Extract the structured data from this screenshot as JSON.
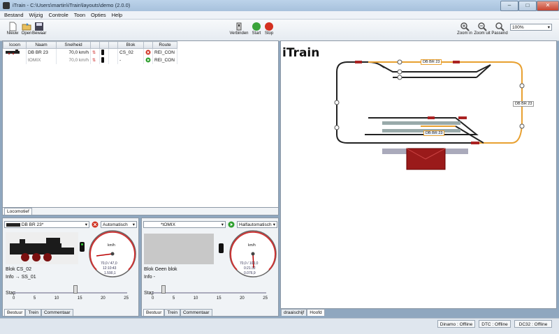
{
  "window": {
    "title": "iTrain - C:\\Users\\martin\\iTrain\\layouts\\demo (2.0.0)"
  },
  "menu": [
    "Bestand",
    "Wijzig",
    "Controle",
    "Toon",
    "Opties",
    "Help"
  ],
  "toolbar": {
    "new": "Nieuw",
    "open": "Open",
    "save": "Bewaar",
    "connect": "Verbinden",
    "start": "Start",
    "stop": "Stop",
    "zoom_in": "Zoom in",
    "zoom_out": "Zoom uit",
    "fit": "Passend",
    "zoom_value": "100%"
  },
  "loco_table": {
    "headers": [
      "Icoon",
      "Naam",
      "Snelheid",
      "Blok",
      "Route"
    ],
    "rows": [
      {
        "name": "DB BR 23",
        "speed": "70,0 km/h",
        "block": "CS_02",
        "route": "REI_CON"
      },
      {
        "name": "tOMIX",
        "speed": "70,0 km/h",
        "block": "-",
        "route": "REI_CON"
      }
    ]
  },
  "left_tabs": [
    "Locomotief"
  ],
  "control1": {
    "loco": "DB BR 23*",
    "mode": "Automatisch",
    "block_label": "Blok",
    "block_value": "CS_02",
    "info_label": "Info",
    "info_value": "→ SS_01",
    "step_label": "Stap",
    "gauge_unit": "km/h",
    "gauge_speed": "70,0 / 47,0",
    "gauge_time": "12:10:43",
    "gauge_dist": "1.590,1",
    "scale": [
      "0",
      "5",
      "10",
      "15",
      "20",
      "25"
    ],
    "tabs": [
      "Bestuur",
      "Trein",
      "Commentaar"
    ]
  },
  "control2": {
    "loco": "*tOMIX",
    "mode": "Halfautomatisch",
    "block_label": "Blok",
    "block_value": "Geen blok",
    "info_label": "Info",
    "info_value": "-",
    "step_label": "Stap",
    "gauge_unit": "km/h",
    "gauge_speed": "70,0 / 100,0",
    "gauge_time": "0:21:32",
    "gauge_dist": "0.076,9",
    "scale": [
      "0",
      "5",
      "10",
      "15",
      "20",
      "25"
    ],
    "tabs": [
      "Bestuur",
      "Trein",
      "Commentaar"
    ]
  },
  "gauge_ticks": [
    "0",
    "20",
    "40",
    "60",
    "80",
    "100",
    "120",
    "140",
    "160",
    "180",
    "200",
    "220",
    "240"
  ],
  "layout": {
    "logo": "iTrain",
    "label_top": "DB BR 23",
    "label_right": "DB BR 23",
    "label_mid": "DB BR 23",
    "tabs": [
      "draaischijf",
      "Hoofd"
    ]
  },
  "status": [
    "Dinamo : Offline",
    "DTC : Offline",
    "DC32 : Offline"
  ],
  "colors": {
    "track_active": "#e8a030",
    "track": "#222222",
    "stop": "#d03020",
    "go": "#30a030"
  }
}
